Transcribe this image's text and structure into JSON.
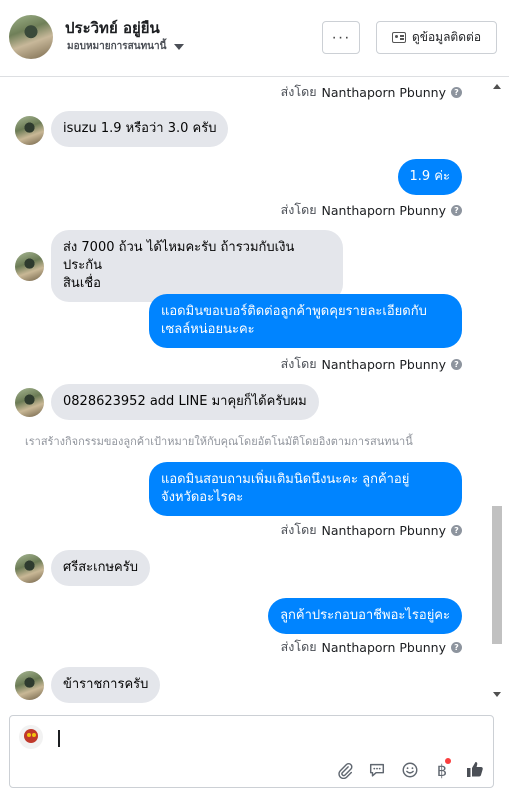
{
  "header": {
    "name": "ประวิทย์ อยู่ยืน",
    "subtitle": "มอบหมายการสนทนานี้",
    "more_label": "···",
    "contact_button": "ดูข้อมูลติดต่อ"
  },
  "sent_by": {
    "prefix": "ส่งโดย",
    "name": "Nanthaporn Pbunny",
    "info": "?"
  },
  "messages": [
    {
      "dir": "in",
      "text": "isuzu 1.9 หรือว่า 3.0 ครับ"
    },
    {
      "dir": "out",
      "text": "1.9 ค่ะ"
    },
    {
      "dir": "in",
      "text": "ส่ง 7000 ถ้วน ได้ไหมคะรับ ถ้ารวมกับเงินประกัน",
      "text2": "สินเชื่อ"
    },
    {
      "dir": "out",
      "text": "แอดมินขอเบอร์ติดต่อลูกค้าพูดคุยรายละเอียดกับ",
      "text2": "เซลล์หน่อยนะคะ"
    },
    {
      "dir": "in",
      "text": "0828623952 add LINE มาคุยก็ได้ครับผม"
    },
    {
      "dir": "out",
      "text": "แอดมินสอบถามเพิ่มเติมนิดนึงนะคะ ลูกค้าอยู่",
      "text2": "จังหวัดอะไรคะ"
    },
    {
      "dir": "in",
      "text": "ศรีสะเกษครับ"
    },
    {
      "dir": "out",
      "text": "ลูกค้าประกอบอาชีพอะไรอยู่คะ"
    },
    {
      "dir": "in",
      "text": "ข้าราชการครับ"
    }
  ],
  "notice": "เราสร้างกิจกรรมของลูกค้าเป้าหมายให้กับคุณโดยอัตโนมัติโดยอิงตามการสนทนานี้",
  "composer": {
    "value": "",
    "icons": [
      "paperclip-icon",
      "quick-reply-icon",
      "emoji-icon",
      "baht-payment-icon",
      "like-icon"
    ],
    "baht_symbol": "฿"
  },
  "colors": {
    "outgoing": "#0084ff",
    "incoming": "#e4e6eb",
    "notification_dot": "#fa3e3e"
  }
}
